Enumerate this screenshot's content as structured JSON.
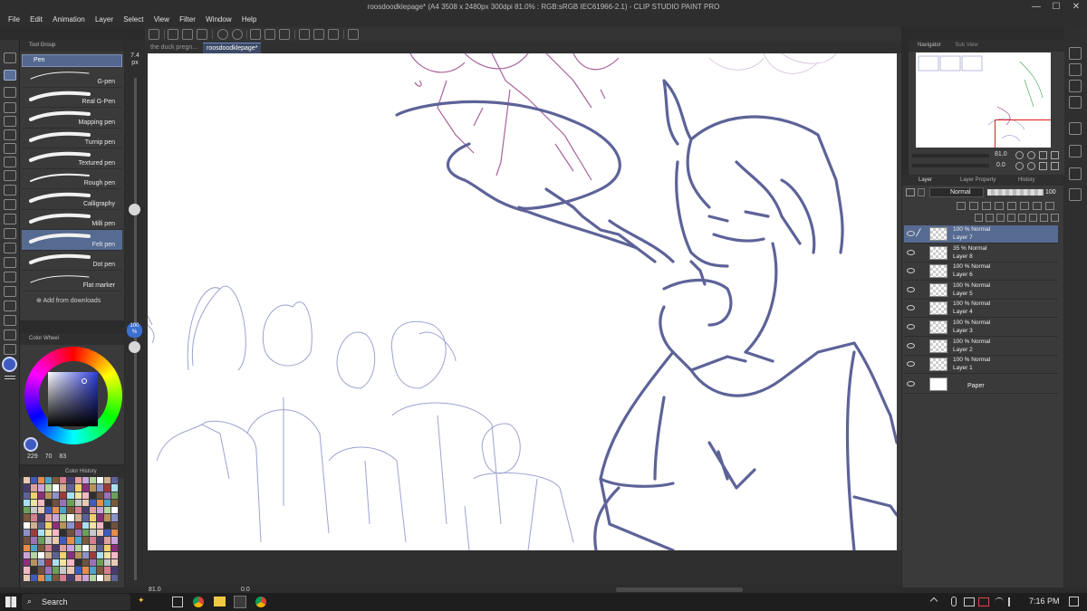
{
  "window": {
    "title": "roosdoodklepage* (A4 3508 x 2480px 300dpi 81.0% : RGB:sRGB IEC61966-2.1)  - CLIP STUDIO PAINT PRO",
    "minimize": "—",
    "maximize": "☐",
    "close": "✕"
  },
  "menu": [
    "File",
    "Edit",
    "Animation",
    "Layer",
    "Select",
    "View",
    "Filter",
    "Window",
    "Help"
  ],
  "tabs": [
    {
      "label": "the duck pregn..."
    },
    {
      "label": "roosdoodklepage*"
    }
  ],
  "subtool": {
    "group_title": "Tool Group",
    "category": "Pen",
    "brushes": [
      "G-pen",
      "Real G-Pen",
      "Mapping pen",
      "Turnip pen",
      "Textured pen",
      "Rough pen",
      "Calligraphy",
      "Milli pen",
      "Felt pen",
      "Dot pen",
      "Flat marker"
    ],
    "selected": "Felt pen",
    "add_label": "Add from downloads"
  },
  "brush_size": {
    "value": "7.4",
    "unit": "px",
    "opacity_value": "100",
    "opacity_unit": "%"
  },
  "color_wheel": {
    "title": "Color Wheel",
    "h": "229",
    "s": "70",
    "v": "83",
    "current_color": "#3f5bbf"
  },
  "color_history": {
    "title": "Color History"
  },
  "navigator": {
    "tabs": [
      "Navigator",
      "Sub View"
    ],
    "zoom": "81.0",
    "rotation": "0.0"
  },
  "layer_panel": {
    "tabs": [
      "Layer",
      "Layer Property",
      "History"
    ],
    "blend_mode": "Normal",
    "opacity": "100",
    "layers": [
      {
        "line1": "100 % Normal",
        "line2": "Layer 7",
        "selected": true
      },
      {
        "line1": "35 % Normal",
        "line2": "Layer 8",
        "selected": false
      },
      {
        "line1": "100 % Normal",
        "line2": "Layer 6",
        "selected": false
      },
      {
        "line1": "100 % Normal",
        "line2": "Layer 5",
        "selected": false
      },
      {
        "line1": "100 % Normal",
        "line2": "Layer 4",
        "selected": false
      },
      {
        "line1": "100 % Normal",
        "line2": "Layer 3",
        "selected": false
      },
      {
        "line1": "100 % Normal",
        "line2": "Layer 2",
        "selected": false
      },
      {
        "line1": "100 % Normal",
        "line2": "Layer 1",
        "selected": false
      }
    ],
    "paper_label": "Paper"
  },
  "status": {
    "zoom": "81.0",
    "angle": "0.0"
  },
  "taskbar": {
    "search_label": "Search",
    "time": "7:16 PM"
  },
  "colors": {
    "ink": "#5d6398",
    "sketch_purple": "#8a2f7c",
    "sketch_blue": "#8c93c9",
    "accent": "#566b92"
  }
}
